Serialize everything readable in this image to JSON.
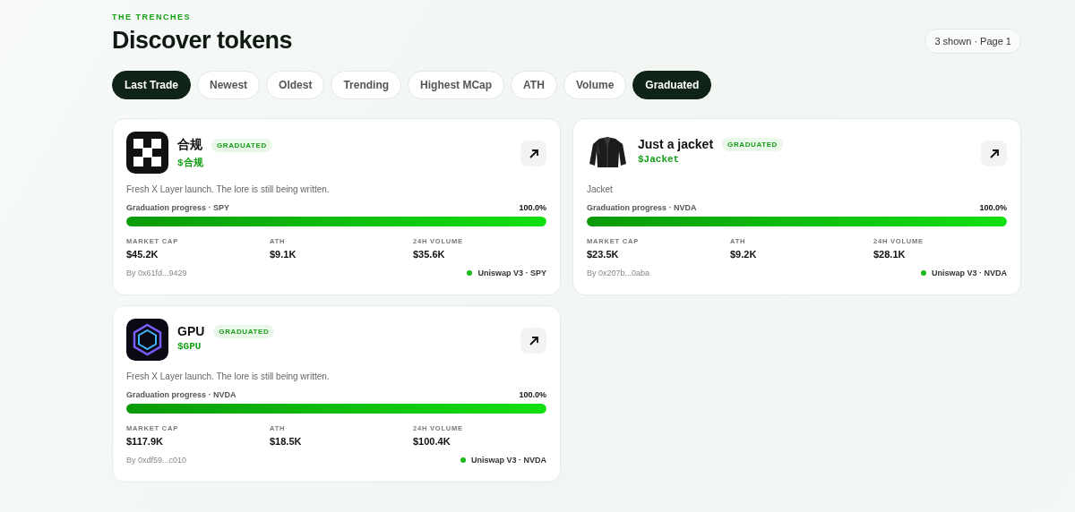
{
  "header": {
    "eyebrow": "THE TRENCHES",
    "title": "Discover tokens",
    "page_info": "3 shown · Page 1"
  },
  "filters": [
    {
      "label": "Last Trade",
      "selected": true
    },
    {
      "label": "Newest",
      "selected": false
    },
    {
      "label": "Oldest",
      "selected": false
    },
    {
      "label": "Trending",
      "selected": false
    },
    {
      "label": "Highest MCap",
      "selected": false
    },
    {
      "label": "ATH",
      "selected": false
    },
    {
      "label": "Volume",
      "selected": false
    },
    {
      "label": "Graduated",
      "selected": true
    }
  ],
  "tokens": [
    {
      "kind": "checker",
      "name": "合规",
      "badge": "GRADUATED",
      "ticker": "$合规",
      "description": "Fresh X Layer launch. The lore is still being written.",
      "progress_label": "Graduation progress · SPY",
      "progress_value": "100.0%",
      "level": 1,
      "stats": [
        {
          "label": "MARKET CAP",
          "value": "$45.2K"
        },
        {
          "label": "ATH",
          "value": "$9.1K"
        },
        {
          "label": "24H VOLUME",
          "value": "$35.6K"
        }
      ],
      "creator": "By 0x61fd...9429",
      "venue": "Uniswap V3 · SPY",
      "color": "#1cb81c"
    },
    {
      "kind": "picture",
      "name": "Just a jacket",
      "badge": "GRADUATED",
      "ticker": "$Jacket",
      "description": "Jacket",
      "progress_label": "Graduation progress · NVDA",
      "progress_value": "100.0%",
      "level": 1,
      "stats": [
        {
          "label": "MARKET CAP",
          "value": "$23.5K"
        },
        {
          "label": "ATH",
          "value": "$9.2K"
        },
        {
          "label": "24H VOLUME",
          "value": "$28.1K"
        }
      ],
      "creator": "By 0x207b...0aba",
      "venue": "Uniswap V3 · NVDA",
      "color": "#1cb81c"
    },
    {
      "kind": "hexagon",
      "name": "GPU",
      "badge": "GRADUATED",
      "ticker": "$GPU",
      "description": "Fresh X Layer launch. The lore is still being written.",
      "progress_label": "Graduation progress · NVDA",
      "progress_value": "100.0%",
      "level": 1,
      "stats": [
        {
          "label": "MARKET CAP",
          "value": "$117.9K"
        },
        {
          "label": "ATH",
          "value": "$18.5K"
        },
        {
          "label": "24H VOLUME",
          "value": "$100.4K"
        }
      ],
      "creator": "By 0xdf59...c010",
      "venue": "Uniswap V3 · NVDA",
      "color": "#1cb81c"
    }
  ]
}
